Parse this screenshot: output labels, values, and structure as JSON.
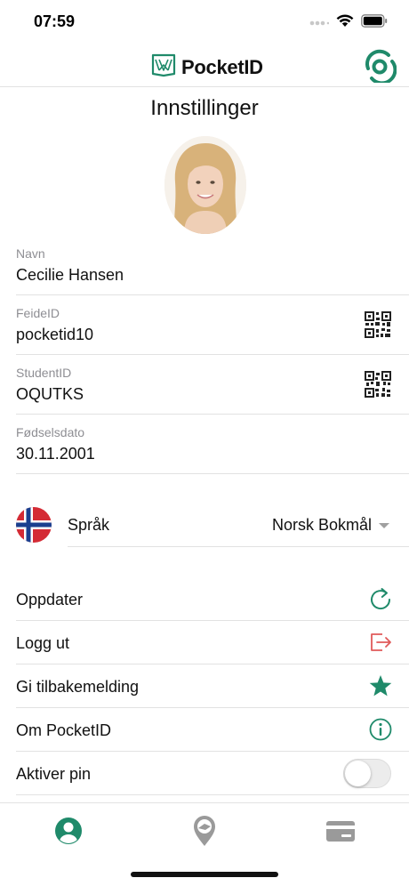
{
  "status_bar": {
    "time": "07:59"
  },
  "header": {
    "brand_name": "PocketID"
  },
  "page": {
    "title": "Innstillinger"
  },
  "profile_fields": [
    {
      "label": "Navn",
      "value": "Cecilie Hansen"
    },
    {
      "label": "FeideID",
      "value": "pocketid10"
    },
    {
      "label": "StudentID",
      "value": "OQUTKS"
    },
    {
      "label": "Fødselsdato",
      "value": "30.11.2001"
    }
  ],
  "language": {
    "label": "Språk",
    "selected": "Norsk Bokmål",
    "flag": "norway-flag-icon"
  },
  "actions": [
    {
      "label": "Oppdater",
      "icon": "refresh-icon"
    },
    {
      "label": "Logg ut",
      "icon": "logout-icon"
    },
    {
      "label": "Gi tilbakemelding",
      "icon": "star-icon"
    },
    {
      "label": "Om PocketID",
      "icon": "info-icon"
    }
  ],
  "pin": {
    "label": "Aktiver pin",
    "enabled": false
  },
  "tabs": [
    {
      "icon": "profile-icon",
      "active": true
    },
    {
      "icon": "location-pin-icon",
      "active": false
    },
    {
      "icon": "card-icon",
      "active": false
    }
  ],
  "colors": {
    "accent": "#1f8a6a",
    "logout": "#e05a5a",
    "inactive_icon": "#9a9a9a",
    "divider": "#e2e2e2"
  }
}
